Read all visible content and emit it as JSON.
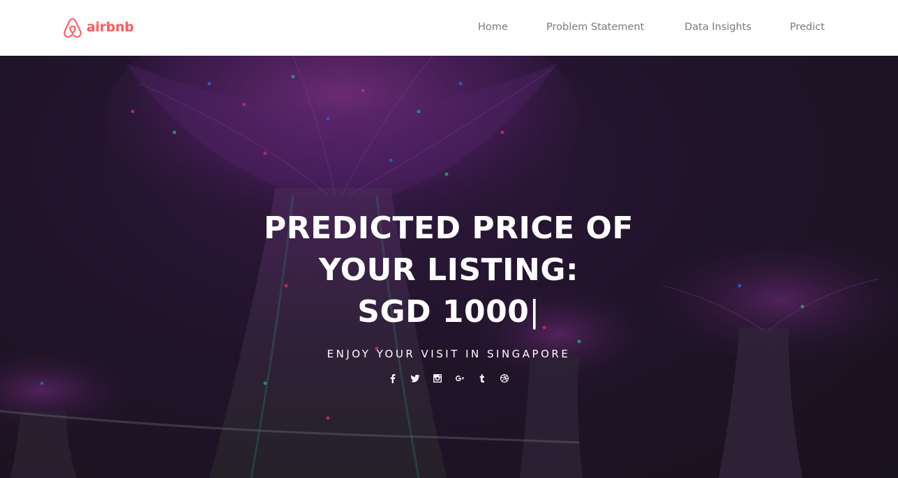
{
  "brand": {
    "name": "airbnb",
    "color": "#FF5A5F"
  },
  "nav": {
    "items": [
      {
        "label": "Home"
      },
      {
        "label": "Problem Statement"
      },
      {
        "label": "Data Insights"
      },
      {
        "label": "Predict"
      }
    ]
  },
  "hero": {
    "title_line1": "PREDICTED PRICE OF",
    "title_line2": "YOUR LISTING:",
    "title_line3": "SGD 1000",
    "cursor": "|",
    "subtitle": "ENJOY YOUR VISIT IN SINGAPORE",
    "background_description_colors": [
      "#7b2a9c",
      "#c23bd6",
      "#2fd08a",
      "#3a7bff",
      "#ff3b6b"
    ]
  },
  "social": [
    {
      "icon": "facebook-icon"
    },
    {
      "icon": "twitter-icon"
    },
    {
      "icon": "instagram-icon"
    },
    {
      "icon": "google-plus-icon"
    },
    {
      "icon": "tumblr-icon"
    },
    {
      "icon": "dribbble-icon"
    }
  ]
}
